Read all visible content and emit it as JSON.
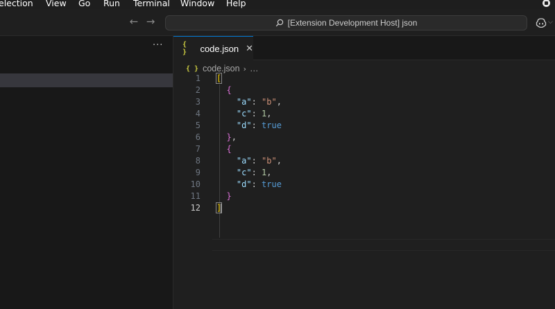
{
  "menubar": {
    "items": [
      "election",
      "View",
      "Go",
      "Run",
      "Terminal",
      "Window",
      "Help"
    ]
  },
  "titlebar": {
    "back_icon": "arrow-left-icon",
    "forward_icon": "arrow-right-icon",
    "command_center": "[Extension Development Host] json",
    "copilot_icon": "copilot-icon"
  },
  "sidebar": {
    "more_actions": "···"
  },
  "editor": {
    "tab": {
      "icon": "{ }",
      "label": "code.json",
      "close": "✕"
    },
    "breadcrumb": {
      "icon": "{ }",
      "file": "code.json",
      "separator": "›",
      "rest": "…"
    },
    "active_line": 12,
    "lines": [
      [
        {
          "t": "[",
          "c": "bracket",
          "m": true
        }
      ],
      [
        {
          "t": "  "
        },
        {
          "t": "{",
          "c": "brace"
        }
      ],
      [
        {
          "t": "    "
        },
        {
          "t": "\"a\"",
          "c": "key"
        },
        {
          "t": ": ",
          "c": "punc"
        },
        {
          "t": "\"b\"",
          "c": "str"
        },
        {
          "t": ",",
          "c": "punc"
        }
      ],
      [
        {
          "t": "    "
        },
        {
          "t": "\"c\"",
          "c": "key"
        },
        {
          "t": ": ",
          "c": "punc"
        },
        {
          "t": "1",
          "c": "num"
        },
        {
          "t": ",",
          "c": "punc"
        }
      ],
      [
        {
          "t": "    "
        },
        {
          "t": "\"d\"",
          "c": "key"
        },
        {
          "t": ": ",
          "c": "punc"
        },
        {
          "t": "true",
          "c": "bool"
        }
      ],
      [
        {
          "t": "  "
        },
        {
          "t": "}",
          "c": "brace"
        },
        {
          "t": ",",
          "c": "punc"
        }
      ],
      [
        {
          "t": "  "
        },
        {
          "t": "{",
          "c": "brace"
        }
      ],
      [
        {
          "t": "    "
        },
        {
          "t": "\"a\"",
          "c": "key"
        },
        {
          "t": ": ",
          "c": "punc"
        },
        {
          "t": "\"b\"",
          "c": "str"
        },
        {
          "t": ",",
          "c": "punc"
        }
      ],
      [
        {
          "t": "    "
        },
        {
          "t": "\"c\"",
          "c": "key"
        },
        {
          "t": ": ",
          "c": "punc"
        },
        {
          "t": "1",
          "c": "num"
        },
        {
          "t": ",",
          "c": "punc"
        }
      ],
      [
        {
          "t": "    "
        },
        {
          "t": "\"d\"",
          "c": "key"
        },
        {
          "t": ": ",
          "c": "punc"
        },
        {
          "t": "true",
          "c": "bool"
        }
      ],
      [
        {
          "t": "  "
        },
        {
          "t": "}",
          "c": "brace"
        }
      ],
      [
        {
          "t": "]",
          "c": "bracket",
          "m": true
        }
      ]
    ]
  }
}
